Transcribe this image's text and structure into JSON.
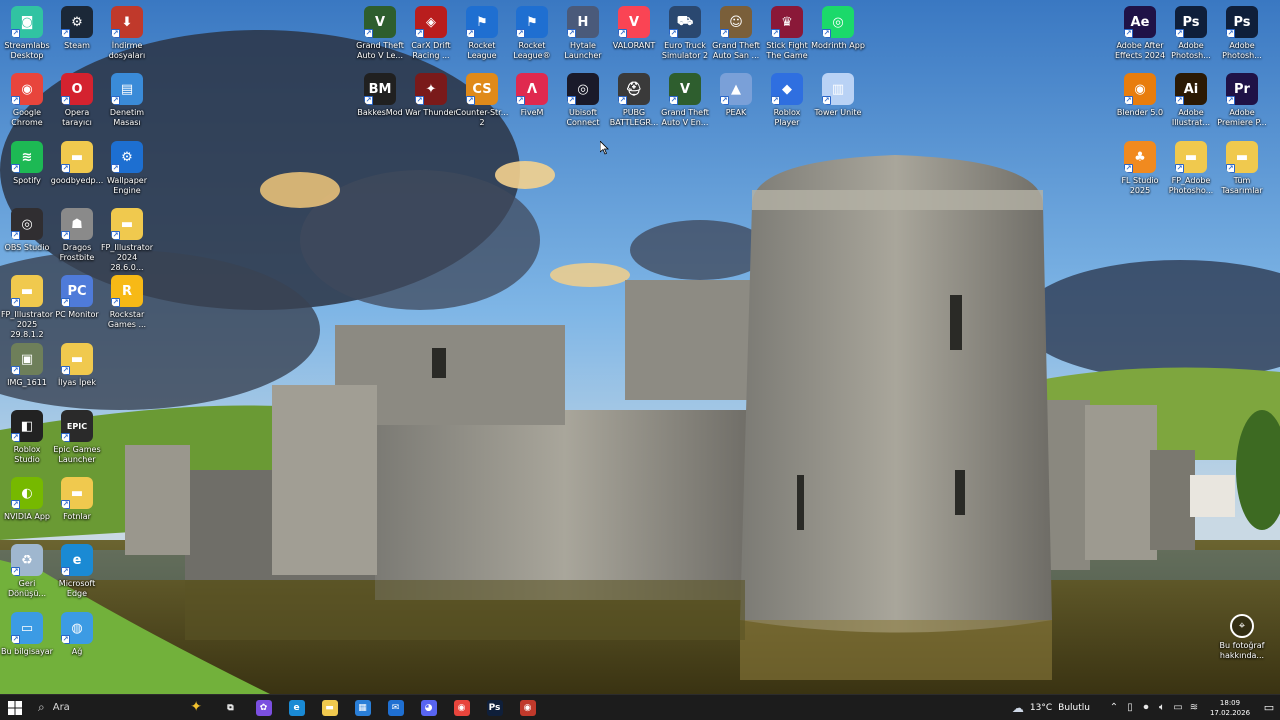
{
  "desktop_icons": [
    {
      "label": "Streamlabs Desktop",
      "icon": "streamlabs-icon",
      "bg": "#31c3a2",
      "glyph": "◙",
      "col": 0,
      "row": 0
    },
    {
      "label": "Steam",
      "icon": "steam-icon",
      "bg": "#1b2838",
      "glyph": "⚙",
      "col": 1,
      "row": 0
    },
    {
      "label": "İndirme dosyaları",
      "icon": "folder-download-icon",
      "bg": "#c0392b",
      "glyph": "⬇",
      "col": 2,
      "row": 0
    },
    {
      "label": "Google Chrome",
      "icon": "chrome-icon",
      "bg": "#e8453c",
      "glyph": "◉",
      "col": 0,
      "row": 1
    },
    {
      "label": "Opera tarayıcı",
      "icon": "opera-icon",
      "bg": "#d4222f",
      "glyph": "O",
      "col": 1,
      "row": 1
    },
    {
      "label": "Denetim Masası",
      "icon": "control-panel-icon",
      "bg": "#3a8bd8",
      "glyph": "▤",
      "col": 2,
      "row": 1
    },
    {
      "label": "Spotify",
      "icon": "spotify-icon",
      "bg": "#1db954",
      "glyph": "≋",
      "col": 0,
      "row": 2
    },
    {
      "label": "goodbyedp...",
      "icon": "folder-icon",
      "bg": "#f0c94e",
      "glyph": "▬",
      "col": 1,
      "row": 2
    },
    {
      "label": "Wallpaper Engine",
      "icon": "wallpaper-engine-icon",
      "bg": "#1d6fd1",
      "glyph": "⚙",
      "col": 2,
      "row": 2
    },
    {
      "label": "OBS Studio",
      "icon": "obs-icon",
      "bg": "#302e31",
      "glyph": "◎",
      "col": 0,
      "row": 3
    },
    {
      "label": "Dragos Frostbite",
      "icon": "dragos-icon",
      "bg": "#8a8a8a",
      "glyph": "☗",
      "col": 1,
      "row": 3
    },
    {
      "label": "FP_Illustrator 2024 28.6.0...",
      "icon": "folder-icon",
      "bg": "#f0c94e",
      "glyph": "▬",
      "col": 2,
      "row": 3
    },
    {
      "label": "FP_Illustrator 2025 29.8.1.2",
      "icon": "folder-icon",
      "bg": "#f0c94e",
      "glyph": "▬",
      "col": 0,
      "row": 4
    },
    {
      "label": "PC Monitor",
      "icon": "pc-monitor-icon",
      "bg": "#4f7bd9",
      "glyph": "PC",
      "col": 1,
      "row": 4
    },
    {
      "label": "Rockstar Games ...",
      "icon": "rockstar-icon",
      "bg": "#f7b916",
      "glyph": "R",
      "col": 2,
      "row": 4
    },
    {
      "label": "IMG_1611",
      "icon": "image-file-icon",
      "bg": "#6e7f5a",
      "glyph": "▣",
      "col": 0,
      "row": 5
    },
    {
      "label": "İlyas İpek",
      "icon": "folder-icon",
      "bg": "#f0c94e",
      "glyph": "▬",
      "col": 1,
      "row": 5
    },
    {
      "label": "Roblox Studio",
      "icon": "roblox-studio-icon",
      "bg": "#222",
      "glyph": "◧",
      "col": 0,
      "row": 6
    },
    {
      "label": "Epic Games Launcher",
      "icon": "epic-games-icon",
      "bg": "#2a2a2a",
      "glyph": "EPIC",
      "col": 1,
      "row": 6
    },
    {
      "label": "NVIDIA App",
      "icon": "nvidia-icon",
      "bg": "#76b900",
      "glyph": "◐",
      "col": 0,
      "row": 7
    },
    {
      "label": "Fotnlar",
      "icon": "folder-icon",
      "bg": "#f0c94e",
      "glyph": "▬",
      "col": 1,
      "row": 7
    },
    {
      "label": "Geri Dönüşü...",
      "icon": "recycle-bin-icon",
      "bg": "#9fb7cf",
      "glyph": "♻",
      "col": 0,
      "row": 8
    },
    {
      "label": "Microsoft Edge",
      "icon": "edge-icon",
      "bg": "#1a8ad4",
      "glyph": "e",
      "col": 1,
      "row": 8
    },
    {
      "label": "Bu bilgisayar",
      "icon": "this-pc-icon",
      "bg": "#3c9be4",
      "glyph": "▭",
      "col": 0,
      "row": 9
    },
    {
      "label": "Ağ",
      "icon": "network-icon",
      "bg": "#3c9be4",
      "glyph": "◍",
      "col": 1,
      "row": 9
    },
    {
      "label": "Grand Theft Auto V Le...",
      "icon": "gta-v-icon",
      "bg": "#2e5e2e",
      "glyph": "V",
      "col": 3,
      "row": 0
    },
    {
      "label": "CarX Drift Racing ...",
      "icon": "carx-icon",
      "bg": "#b91d1d",
      "glyph": "◈",
      "col": 4,
      "row": 0
    },
    {
      "label": "Rocket League",
      "icon": "rocket-league-icon",
      "bg": "#1f6fd1",
      "glyph": "⚑",
      "col": 5,
      "row": 0
    },
    {
      "label": "Rocket League®",
      "icon": "rocket-league-icon",
      "bg": "#1f6fd1",
      "glyph": "⚑",
      "col": 6,
      "row": 0
    },
    {
      "label": "Hytale Launcher",
      "icon": "hytale-icon",
      "bg": "#4a5a7a",
      "glyph": "H",
      "col": 7,
      "row": 0
    },
    {
      "label": "VALORANT",
      "icon": "valorant-icon",
      "bg": "#fa4454",
      "glyph": "V",
      "col": 8,
      "row": 0
    },
    {
      "label": "Euro Truck Simulator 2",
      "icon": "euro-truck-icon",
      "bg": "#2a4870",
      "glyph": "⛟",
      "col": 9,
      "row": 0
    },
    {
      "label": "Grand Theft Auto San ...",
      "icon": "gta-sa-icon",
      "bg": "#7a5f3a",
      "glyph": "☺",
      "col": 10,
      "row": 0
    },
    {
      "label": "Stick Fight The Game",
      "icon": "stick-fight-icon",
      "bg": "#8a1838",
      "glyph": "♛",
      "col": 11,
      "row": 0
    },
    {
      "label": "Modrinth App",
      "icon": "modrinth-icon",
      "bg": "#1bd96a",
      "glyph": "◎",
      "col": 12,
      "row": 0
    },
    {
      "label": "BakkesMod",
      "icon": "bakkesmod-icon",
      "bg": "#202020",
      "glyph": "BM",
      "col": 3,
      "row": 1
    },
    {
      "label": "War Thunder",
      "icon": "war-thunder-icon",
      "bg": "#7a1a1a",
      "glyph": "✦",
      "col": 4,
      "row": 1
    },
    {
      "label": "Counter-Str... 2",
      "icon": "counter-strike-icon",
      "bg": "#e08a1a",
      "glyph": "CS",
      "col": 5,
      "row": 1
    },
    {
      "label": "FiveM",
      "icon": "fivem-icon",
      "bg": "#e0294f",
      "glyph": "Λ",
      "col": 6,
      "row": 1
    },
    {
      "label": "Ubisoft Connect",
      "icon": "ubisoft-icon",
      "bg": "#1a1a2a",
      "glyph": "◎",
      "col": 7,
      "row": 1
    },
    {
      "label": "PUBG BATTLEGR...",
      "icon": "pubg-icon",
      "bg": "#3a3a3a",
      "glyph": "⛑",
      "col": 8,
      "row": 1
    },
    {
      "label": "Grand Theft Auto V En...",
      "icon": "gta-v-icon",
      "bg": "#2e5e2e",
      "glyph": "V",
      "col": 9,
      "row": 1
    },
    {
      "label": "PEAK",
      "icon": "peak-icon",
      "bg": "#7aa0d8",
      "glyph": "▲",
      "col": 10,
      "row": 1
    },
    {
      "label": "Roblox Player",
      "icon": "roblox-icon",
      "bg": "#2f6fe0",
      "glyph": "◆",
      "col": 11,
      "row": 1
    },
    {
      "label": "Tower Unite",
      "icon": "tower-unite-icon",
      "bg": "#b9d2f5",
      "glyph": "▥",
      "col": 12,
      "row": 1
    },
    {
      "label": "Adobe After Effects 2024",
      "icon": "after-effects-icon",
      "bg": "#1f1247",
      "glyph": "Ae",
      "col": 13,
      "row": 0
    },
    {
      "label": "Adobe Photosh...",
      "icon": "photoshop-icon",
      "bg": "#0f1f3a",
      "glyph": "Ps",
      "col": 14,
      "row": 0
    },
    {
      "label": "Adobe Photosh...",
      "icon": "photoshop-icon",
      "bg": "#0f1f3a",
      "glyph": "Ps",
      "col": 15,
      "row": 0
    },
    {
      "label": "Blender 5.0",
      "icon": "blender-icon",
      "bg": "#e87d0d",
      "glyph": "◉",
      "col": 13,
      "row": 1
    },
    {
      "label": "Adobe Illustrat...",
      "icon": "illustrator-icon",
      "bg": "#2b1a05",
      "glyph": "Ai",
      "col": 14,
      "row": 1
    },
    {
      "label": "Adobe Premiere P...",
      "icon": "premiere-icon",
      "bg": "#1f1247",
      "glyph": "Pr",
      "col": 15,
      "row": 1
    },
    {
      "label": "FL Studio 2025",
      "icon": "fl-studio-icon",
      "bg": "#f18a1f",
      "glyph": "♣",
      "col": 13,
      "row": 2
    },
    {
      "label": "FP_Adobe Photosho...",
      "icon": "folder-icon",
      "bg": "#f0c94e",
      "glyph": "▬",
      "col": 14,
      "row": 2
    },
    {
      "label": "Tüm Tasarımlar",
      "icon": "folder-icon",
      "bg": "#f0c94e",
      "glyph": "▬",
      "col": 15,
      "row": 2
    }
  ],
  "spotlight": {
    "label": "Bu fotoğraf hakkında..."
  },
  "taskbar": {
    "search_placeholder": "Ara",
    "pinned": [
      {
        "icon": "task-view-icon",
        "bg": "transparent",
        "glyph": "⧉"
      },
      {
        "icon": "copilot-icon",
        "bg": "#7b4fe0",
        "glyph": "✿"
      },
      {
        "icon": "edge-icon",
        "bg": "#1a8ad4",
        "glyph": "e"
      },
      {
        "icon": "file-explorer-icon",
        "bg": "#f0c94e",
        "glyph": "▬"
      },
      {
        "icon": "microsoft-store-icon",
        "bg": "#2a7fd8",
        "glyph": "▦"
      },
      {
        "icon": "mail-icon",
        "bg": "#1f6fd1",
        "glyph": "✉"
      },
      {
        "icon": "discord-icon",
        "bg": "#5865f2",
        "glyph": "◕"
      },
      {
        "icon": "chrome-icon",
        "bg": "#e8453c",
        "glyph": "◉"
      },
      {
        "icon": "photoshop-icon",
        "bg": "#0f1f3a",
        "glyph": "Ps"
      },
      {
        "icon": "screen-recorder-icon",
        "bg": "#c0392b",
        "glyph": "◉"
      }
    ],
    "weather": {
      "temp": "13°C",
      "condition": "Bulutlu"
    },
    "clock": {
      "time": "18:09",
      "date": "17.02.2026"
    }
  }
}
